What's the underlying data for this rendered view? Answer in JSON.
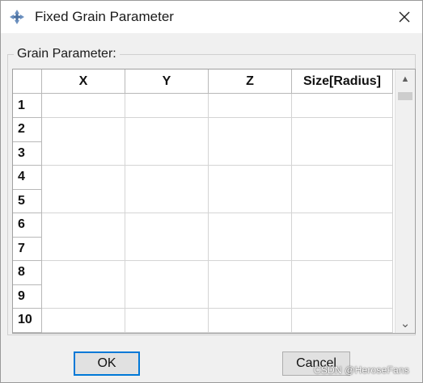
{
  "window": {
    "title": "Fixed Grain Parameter",
    "close_glyph": "✕",
    "icon": "abaqus-app-icon"
  },
  "group": {
    "label": "Grain Parameter:"
  },
  "table": {
    "columns": [
      "X",
      "Y",
      "Z",
      "Size[Radius]"
    ],
    "rows": [
      "1",
      "2",
      "3",
      "4",
      "5",
      "6",
      "7",
      "8",
      "9",
      "10"
    ]
  },
  "scrollbar": {
    "up_glyph": "▲",
    "down_glyph": "⌄"
  },
  "buttons": {
    "ok": "OK",
    "cancel": "Cancel"
  },
  "watermark": "CSDN @HeroseFans",
  "colors": {
    "focus_border": "#0078d7",
    "button_bg": "#e1e1e1",
    "dialog_bg": "#f0f0f0"
  }
}
